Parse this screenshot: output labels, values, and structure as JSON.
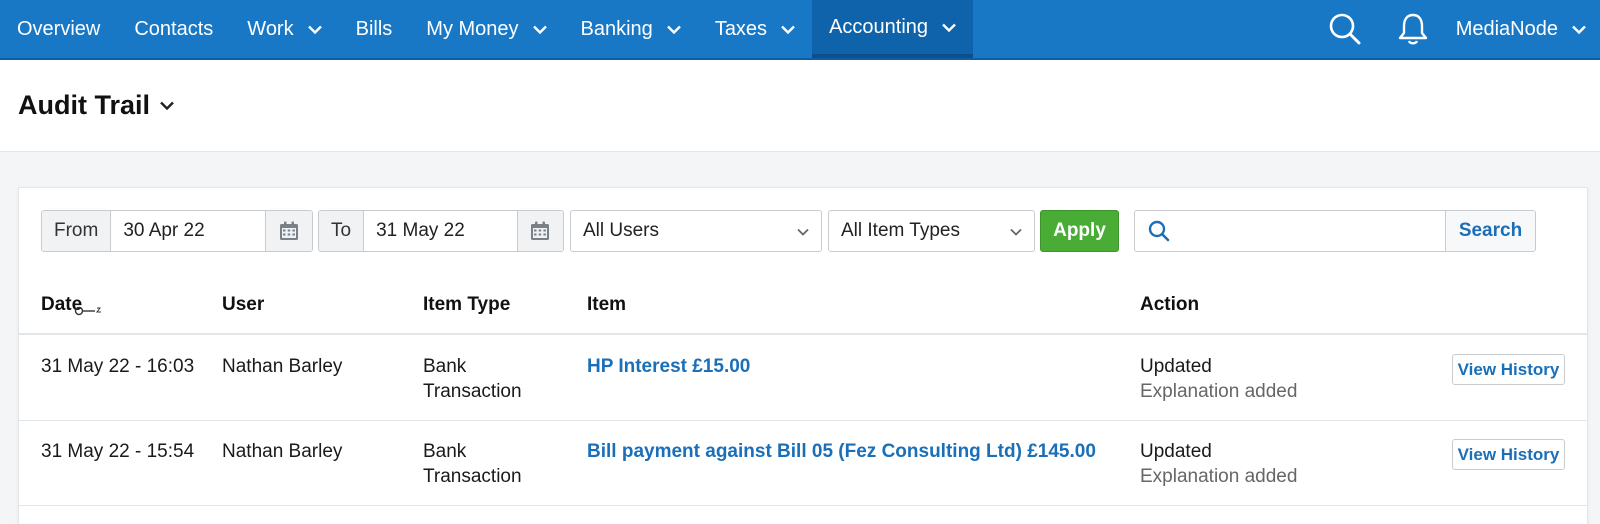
{
  "nav": {
    "items": [
      {
        "label": "Overview",
        "dropdown": false
      },
      {
        "label": "Contacts",
        "dropdown": false
      },
      {
        "label": "Work",
        "dropdown": true
      },
      {
        "label": "Bills",
        "dropdown": false
      },
      {
        "label": "My Money",
        "dropdown": true
      },
      {
        "label": "Banking",
        "dropdown": true
      },
      {
        "label": "Taxes",
        "dropdown": true
      },
      {
        "label": "Accounting",
        "dropdown": true,
        "active": true
      }
    ],
    "company": "MediaNode",
    "search_icon": "search-icon",
    "notifications_icon": "bell-icon"
  },
  "page": {
    "title": "Audit Trail"
  },
  "filters": {
    "from_label": "From",
    "from_date": "30 Apr 22",
    "to_label": "To",
    "to_date": "31 May 22",
    "users_select": "All Users",
    "item_types_select": "All Item Types",
    "apply_label": "Apply",
    "search_placeholder": "",
    "search_button": "Search"
  },
  "table": {
    "columns": [
      "Date",
      "User",
      "Item Type",
      "Item",
      "Action"
    ],
    "rows": [
      {
        "date": "31 May 22 - 16:03",
        "user": "Nathan Barley",
        "item_type_line1": "Bank",
        "item_type_line2": "Transaction",
        "item": "HP Interest £15.00",
        "action": "Updated",
        "action_detail": "Explanation added",
        "button": "View History"
      },
      {
        "date": "31 May 22 - 15:54",
        "user": "Nathan Barley",
        "item_type_line1": "Bank",
        "item_type_line2": "Transaction",
        "item": "Bill payment against Bill 05 (Fez Consulting Ltd) £145.00",
        "action": "Updated",
        "action_detail": "Explanation added",
        "button": "View History"
      }
    ]
  },
  "colors": {
    "nav_bg": "#1878c6",
    "nav_active": "#0f63aa",
    "apply_green": "#49ac35",
    "link_blue": "#1a6fb8"
  }
}
